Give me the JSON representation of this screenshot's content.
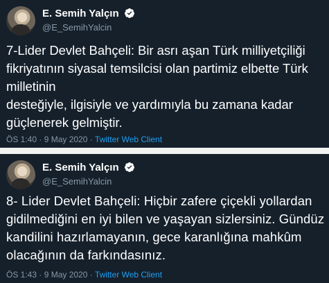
{
  "colors": {
    "background": "#15202b",
    "separator": "#f2f2f2",
    "text": "#ffffff",
    "secondary_text": "#8899a6",
    "link": "#1da1f2",
    "verified_badge": "#ffffff"
  },
  "tweets": [
    {
      "author": {
        "display_name": "E. Semih Yalçın",
        "handle": "@E_SemihYalcin",
        "verified": true
      },
      "lines": [
        "7-Lider Devlet Bahçeli: Bir asrı aşan Türk milliyetçiliği",
        "fikriyatının siyasal temsilcisi olan partimiz elbette Türk",
        "milletinin",
        "desteğiyle, ilgisiyle ve yardımıyla bu zamana kadar",
        "güçlenerek gelmiştir."
      ],
      "time": "ÖS 1:40",
      "separator": "·",
      "date": "9 May 2020",
      "source": "Twitter Web Client"
    },
    {
      "author": {
        "display_name": "E. Semih Yalçın",
        "handle": "@E_SemihYalcin",
        "verified": true
      },
      "lines": [
        "8- Lider Devlet Bahçeli: Hiçbir zafere çiçekli yollardan",
        "gidilmediğini en iyi bilen ve yaşayan sizlersiniz. Gündüz",
        "kandilini hazırlamayanın, gece karanlığına mahkûm",
        "olacağının da farkındasınız."
      ],
      "time": "ÖS 1:43",
      "separator": "·",
      "date": "9 May 2020",
      "source": "Twitter Web Client"
    }
  ]
}
